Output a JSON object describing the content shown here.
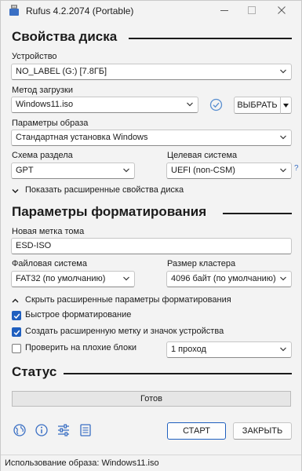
{
  "window": {
    "title": "Rufus 4.2.2074 (Portable)"
  },
  "drive_properties": {
    "heading": "Свойства диска",
    "device_label": "Устройство",
    "device_value": "NO_LABEL (G:) [7.8ГБ]",
    "boot_method_label": "Метод загрузки",
    "boot_method_value": "Windows11.iso",
    "select_button": "ВЫБРАТЬ",
    "image_options_label": "Параметры образа",
    "image_options_value": "Стандартная установка Windows",
    "partition_scheme_label": "Схема раздела",
    "partition_scheme_value": "GPT",
    "target_system_label": "Целевая система",
    "target_system_value": "UEFI (non-CSM)",
    "help_mark": "?",
    "advanced_toggle": "Показать расширенные свойства диска"
  },
  "format_options": {
    "heading": "Параметры форматирования",
    "volume_label_label": "Новая метка тома",
    "volume_label_value": "ESD-ISO",
    "file_system_label": "Файловая система",
    "file_system_value": "FAT32 (по умолчанию)",
    "cluster_size_label": "Размер кластера",
    "cluster_size_value": "4096 байт (по умолчанию)",
    "advanced_toggle": "Скрыть расширенные параметры форматирования",
    "quick_format": {
      "label": "Быстрое форматирование",
      "checked": true
    },
    "extended_label": {
      "label": "Создать расширенную метку и значок устройства",
      "checked": true
    },
    "bad_blocks": {
      "label": "Проверить на плохие блоки",
      "checked": false
    },
    "passes_value": "1 проход"
  },
  "status": {
    "heading": "Статус",
    "text": "Готов"
  },
  "toolbar": {
    "icons": [
      "globe-icon",
      "info-icon",
      "settings-sliders-icon",
      "log-icon"
    ],
    "start_button": "СТАРТ",
    "close_button": "ЗАКРЫТЬ"
  },
  "footer": {
    "text": "Использование образа: Windows11.iso"
  },
  "colors": {
    "accent": "#1f5fbf",
    "background": "#f3f3f3",
    "check_icon": "#5a8fd0"
  }
}
